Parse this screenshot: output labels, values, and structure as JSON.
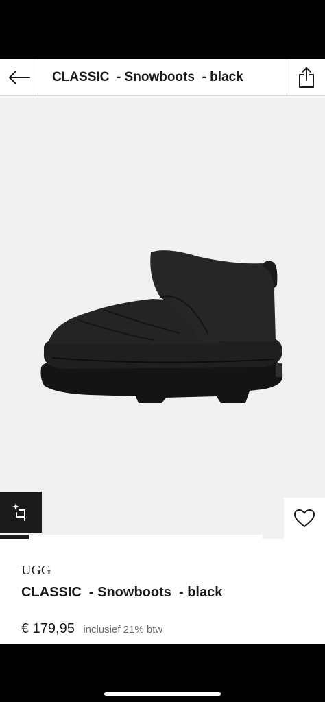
{
  "header": {
    "title": "CLASSIC  - Snowboots  - black",
    "back_icon": "arrow-left-icon",
    "share_icon": "share-icon"
  },
  "gallery": {
    "image": "black-snow-boot",
    "progress": 0.11,
    "edit_icon": "sparkle-crop-icon",
    "wishlist_icon": "heart-icon"
  },
  "product": {
    "brand": "UGG",
    "name": "CLASSIC  - Snowboots  - black",
    "price": "€ 179,95",
    "vat_note": "inclusief 21% btw"
  },
  "colors": {
    "accent": "#1a1a1a",
    "image_background": "#f1f1f1"
  }
}
